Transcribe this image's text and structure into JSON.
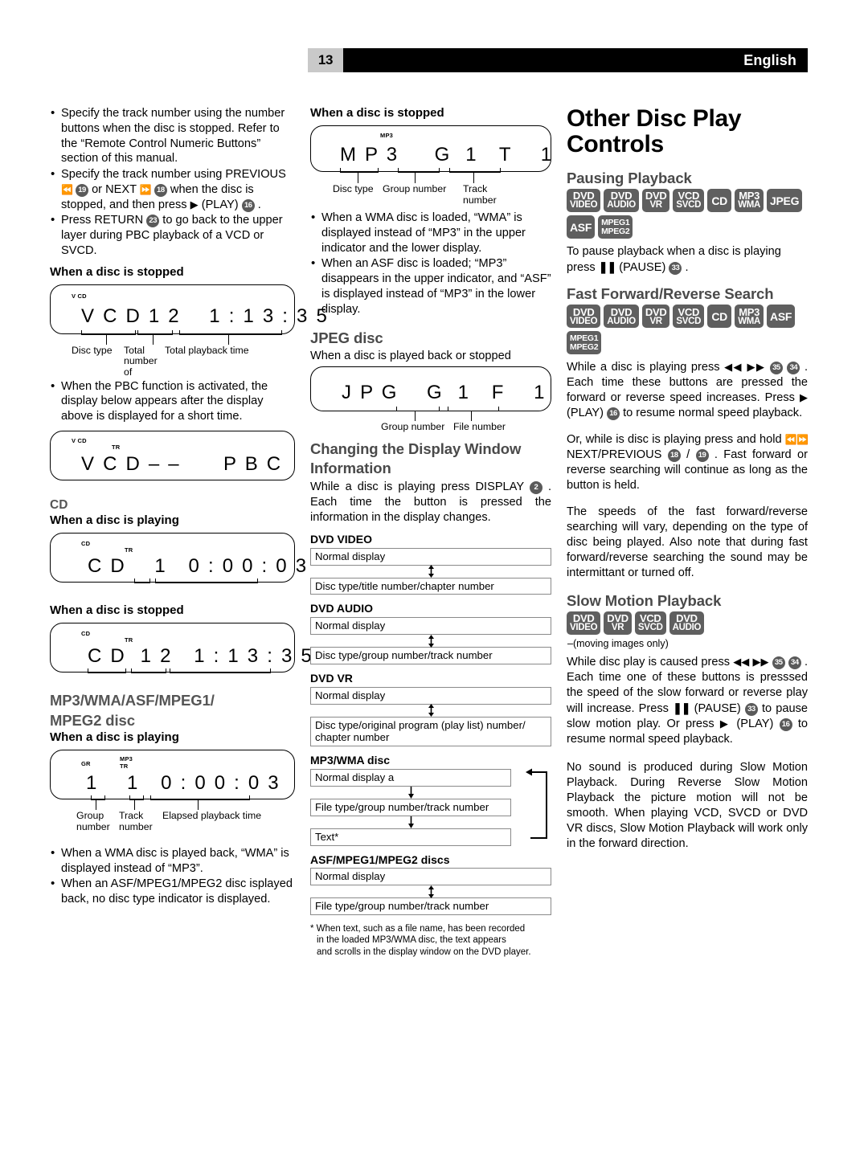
{
  "header": {
    "page_number": "13",
    "language": "English"
  },
  "col1": {
    "bullets_top": [
      "Specify the track number using the number buttons when the disc is stopped. Refer to the “Remote Control Numeric Buttons” section of this manual.",
      "Specify the track number using PREVIOUS ⏮ 19 or NEXT ⏭ 18 when the disc is stopped, and then press ▶ (PLAY) 16 .",
      "Press RETURN 23 to go back to the upper layer during PBC playback of a VCD or SVCD."
    ],
    "vcd_stopped_heading": "When a disc is stopped",
    "vcd_lcd": {
      "indicator": "V CD",
      "segments": "V C D 1 2    1 : 1 3 : 3 5",
      "callout_disc_type": "Disc type",
      "callout_total_number": "Total number of",
      "callout_total_time": "Total playback time"
    },
    "pbc_bullet": "When the PBC function is activated, the display below appears after the display above is displayed for a short time.",
    "pbc_lcd": {
      "indicator1": "V CD",
      "indicator2": "TR",
      "segments": "V C D – –      P B C"
    },
    "cd_heading": "CD",
    "cd_playing_heading": "When a disc is playing",
    "cd_playing_lcd": {
      "indicator1": "CD",
      "indicator2": "TR",
      "segments": "C D    1   0 : 0 0 : 0 3"
    },
    "cd_stopped_heading": "When a disc is stopped",
    "cd_stopped_lcd": {
      "indicator1": "CD",
      "indicator2": "TR",
      "segments": "C D  1 2   1 : 1 3 : 3 5"
    },
    "mp3_heading_line1": "MP3/WMA/ASF/MPEG1/",
    "mp3_heading_line2": "MPEG2 disc",
    "mp3_playing_heading": "When a disc is playing",
    "mp3_playing_lcd": {
      "indicator_gr": "GR",
      "indicator_mp3": "MP3",
      "indicator_tr": "TR",
      "segments": "1    1   0 : 0 0 : 0 3",
      "callout_group": "Group number",
      "callout_track": "Track number",
      "callout_elapsed": "Elapsed playback time"
    },
    "bullets_bottom": [
      "When a WMA disc is played back, “WMA” is displayed instead of “MP3”.",
      "When an ASF/MPEG1/MPEG2 disc isplayed back, no disc type indicator is displayed."
    ]
  },
  "col2": {
    "mp3_stopped_heading": "When a disc is stopped",
    "mp3_stopped_lcd": {
      "indicator": "MP3",
      "segments": "M P 3     G  1   T    1",
      "callout_disc_type": "Disc type",
      "callout_group": "Group number",
      "callout_track": "Track number"
    },
    "bullets": [
      "When a WMA disc is loaded, “WMA” is displayed instead of “MP3” in the upper indicator and the lower display.",
      "When an ASF disc is loaded; “MP3” disappears in the upper indicator, and “ASF” is displayed instead of “MP3” in the lower display."
    ],
    "jpeg_heading": "JPEG disc",
    "jpeg_sub": "When a disc is played back or stopped",
    "jpeg_lcd": {
      "segments": "J P G    G  1   F    1",
      "callout_group": "Group number",
      "callout_file": "File number"
    },
    "changing_heading_line1": "Changing the Display Window",
    "changing_heading_line2": "Information",
    "changing_body": "While a disc is playing press DISPLAY 2 . Each time the button is pressed the information in the display changes.",
    "flows": [
      {
        "title": "DVD VIDEO",
        "boxes": [
          "Normal display",
          "Disc type/title number/chapter number"
        ],
        "arrow": "two-way"
      },
      {
        "title": "DVD AUDIO",
        "boxes": [
          "Normal display",
          "Disc type/group number/track number"
        ],
        "arrow": "two-way"
      },
      {
        "title": "DVD VR",
        "boxes": [
          "Normal display",
          "Disc type/original program (play list) number/ chapter number"
        ],
        "arrow": "two-way"
      },
      {
        "title": "MP3/WMA disc",
        "boxes": [
          "Normal display a",
          "File type/group number/track number",
          "Text*"
        ],
        "arrow": "loop"
      },
      {
        "title": "ASF/MPEG1/MPEG2 discs",
        "boxes": [
          "Normal display",
          "File type/group number/track number"
        ],
        "arrow": "two-way"
      }
    ],
    "footnote_line1": "* When text, such as a file name, has been recorded",
    "footnote_line2": "in the loaded MP3/WMA disc, the text appears",
    "footnote_line3": "and scrolls  in the display window on the DVD player."
  },
  "col3": {
    "title": "Other Disc Play Controls",
    "pausing": {
      "heading": "Pausing Playback",
      "badges": [
        [
          "DVD",
          "VIDEO"
        ],
        [
          "DVD",
          "AUDIO"
        ],
        [
          "DVD",
          "VR"
        ],
        [
          "VCD",
          "SVCD"
        ],
        [
          "CD"
        ],
        [
          "MP3",
          "WMA"
        ],
        [
          "JPEG"
        ],
        [
          "ASF"
        ],
        [
          "MPEG1",
          "MPEG2"
        ]
      ],
      "body": "To pause playback when a disc is playing press ❘❘ (PAUSE) 33 ."
    },
    "ffrs": {
      "heading": "Fast Forward/Reverse Search",
      "badges": [
        [
          "DVD",
          "VIDEO"
        ],
        [
          "DVD",
          "AUDIO"
        ],
        [
          "DVD",
          "VR"
        ],
        [
          "VCD",
          "SVCD"
        ],
        [
          "CD"
        ],
        [
          "MP3",
          "WMA"
        ],
        [
          "ASF"
        ],
        [
          "MPEG1",
          "MPEG2"
        ]
      ],
      "para1": "While a disc is playing press ◀◀ ▶▶ 35 34 . Each time these buttons are pressed the forward or reverse speed increases. Press ▶ (PLAY) 16 to resume normal speed playback.",
      "para2": "Or, while is disc is playing press and hold ⏮ ⏭ NEXT/PREVIOUS 18 / 19 . Fast forward or reverse searching will continue as long as the button is held.",
      "para3": "The speeds of the fast forward/reverse searching will vary, depending on the type of disc being played. Also note that during fast forward/reverse searching the sound may be intermittant or turned off."
    },
    "slow": {
      "heading": "Slow Motion Playback",
      "badges": [
        [
          "DVD",
          "VIDEO"
        ],
        [
          "DVD",
          "VR"
        ],
        [
          "VCD",
          "SVCD"
        ],
        [
          "DVD",
          "AUDIO"
        ]
      ],
      "badge_note": "–(moving images only)",
      "para1": "While disc play is caused press ◀◀ ▶▶ 35 34 . Each time one of these buttons is presssed the speed of the slow forward or reverse play will increase. Press ❘❘ (PAUSE) 33 to pause slow motion play. Or press ▶ (PLAY) 16 to resume normal speed playback.",
      "para2": "No sound is produced during Slow Motion Playback. During Reverse Slow Motion Playback the picture motion will not be smooth. When playing VCD, SVCD or DVD VR discs, Slow Motion Playback will work only in the forward direction."
    }
  }
}
